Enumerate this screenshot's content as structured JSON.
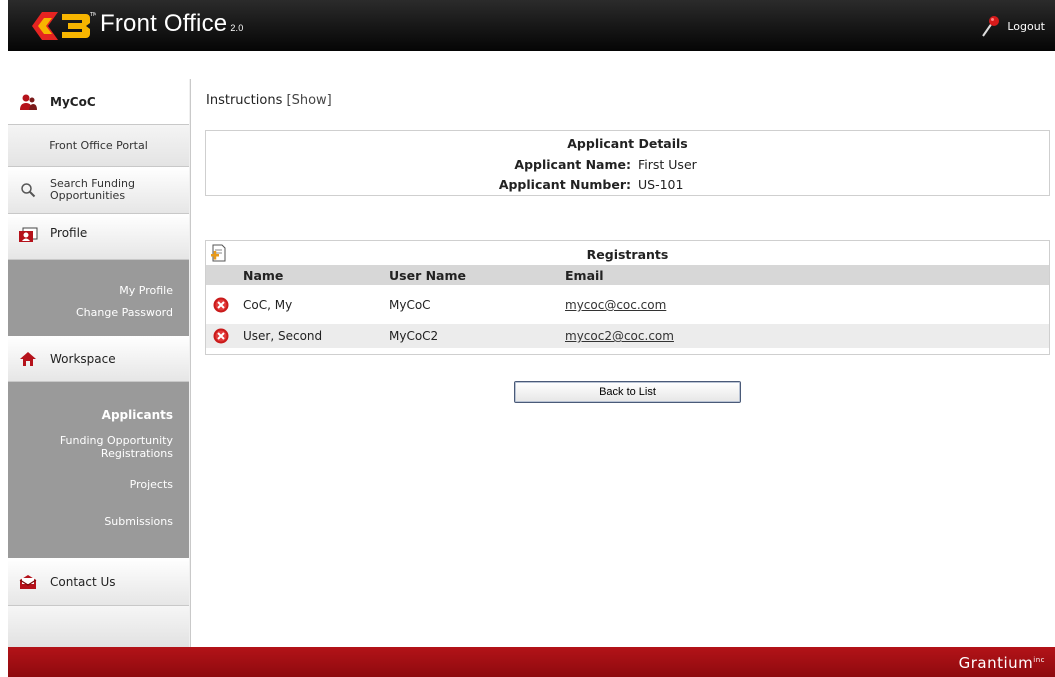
{
  "header": {
    "brand": "Front Office",
    "brand_version": "2.0",
    "logout_label": "Logout"
  },
  "sidebar": {
    "mycoc_label": "MyCoC",
    "front_office_portal_label": "Front Office Portal",
    "search_label_line1": "Search Funding",
    "search_label_line2": "Opportunities",
    "profile_label": "Profile",
    "profile_links": [
      "My Profile",
      "Change Password"
    ],
    "workspace_label": "Workspace",
    "workspace_links": {
      "applicants": "Applicants",
      "funding_line1": "Funding Opportunity",
      "funding_line2": "Registrations",
      "projects": "Projects",
      "submissions": "Submissions"
    },
    "contact_label": "Contact Us"
  },
  "instructions": {
    "label": "Instructions",
    "show": "[Show]"
  },
  "applicant_details": {
    "title": "Applicant Details",
    "name_label": "Applicant Name:",
    "name_value": "First User",
    "number_label": "Applicant Number:",
    "number_value": "US-101"
  },
  "registrants": {
    "title": "Registrants",
    "columns": [
      "Name",
      "User Name",
      "Email"
    ],
    "rows": [
      {
        "name": "CoC, My",
        "username": "MyCoC",
        "email": "mycoc@coc.com"
      },
      {
        "name": "User, Second",
        "username": "MyCoC2",
        "email": "mycoc2@coc.com"
      }
    ]
  },
  "back_button_label": "Back to List",
  "footer": {
    "brand": "Grantium",
    "brand_mark": "inc"
  },
  "colors": {
    "header_bg": "#0a0a0a",
    "footer_bg": "#a50f14",
    "sidebar_group_bg": "#9a9a9a",
    "table_header_bg": "#d7d7d7"
  }
}
